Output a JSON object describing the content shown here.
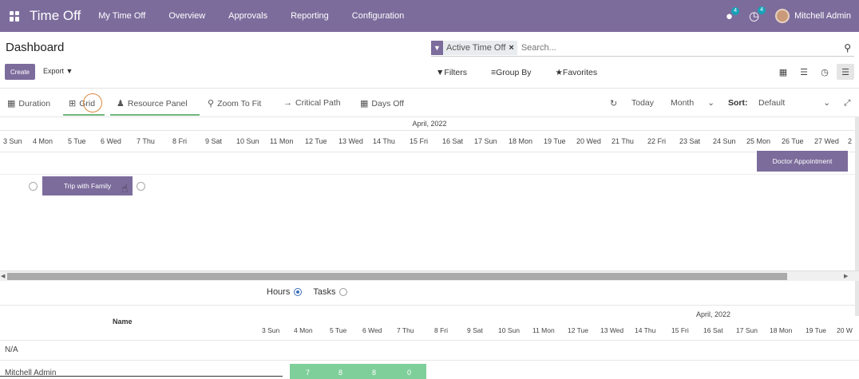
{
  "navbar": {
    "app_title": "Time Off",
    "menu": [
      "My Time Off",
      "Overview",
      "Approvals",
      "Reporting",
      "Configuration"
    ],
    "chat_badge": "4",
    "activity_badge": "4",
    "user_name": "Mitchell Admin"
  },
  "control_panel": {
    "title": "Dashboard",
    "facet_label": "Active Time Off",
    "search_placeholder": "Search...",
    "create_label": "Create",
    "export_label": "Export",
    "filters_label": "Filters",
    "group_by_label": "Group By",
    "favorites_label": "Favorites"
  },
  "gantt_toolbar": {
    "duration": "Duration",
    "grid": "Grid",
    "resource_panel": "Resource Panel",
    "zoom_to_fit": "Zoom To Fit",
    "critical_path": "Critical Path",
    "days_off": "Days Off",
    "today": "Today",
    "scale": "Month",
    "sort_label": "Sort:",
    "sort_value": "Default"
  },
  "timeline": {
    "month": "April, 2022",
    "days": [
      "3 Sun",
      "4 Mon",
      "5 Tue",
      "6 Wed",
      "7 Thu",
      "8 Fri",
      "9 Sat",
      "10 Sun",
      "11 Mon",
      "12 Tue",
      "13 Wed",
      "14 Thu",
      "15 Fri",
      "16 Sat",
      "17 Sun",
      "18 Mon",
      "19 Tue",
      "20 Wed",
      "21 Thu",
      "22 Fri",
      "23 Sat",
      "24 Sun",
      "25 Mon",
      "26 Tue",
      "27 Wed",
      "2"
    ]
  },
  "pills": {
    "doctor": "Doctor Appointment",
    "trip": "Trip with Family"
  },
  "grid": {
    "hours_label": "Hours",
    "tasks_label": "Tasks",
    "name_header": "Name",
    "month": "April, 2022",
    "days": [
      "3 Sun",
      "4 Mon",
      "5 Tue",
      "6 Wed",
      "7 Thu",
      "8 Fri",
      "9 Sat",
      "10 Sun",
      "11 Mon",
      "12 Tue",
      "13 Wed",
      "14 Thu",
      "15 Fri",
      "16 Sat",
      "17 Sun",
      "18 Mon",
      "19 Tue",
      "20 W"
    ],
    "rows": [
      "N/A",
      "Mitchell Admin"
    ],
    "hours": [
      "7",
      "8",
      "8",
      "0"
    ]
  }
}
